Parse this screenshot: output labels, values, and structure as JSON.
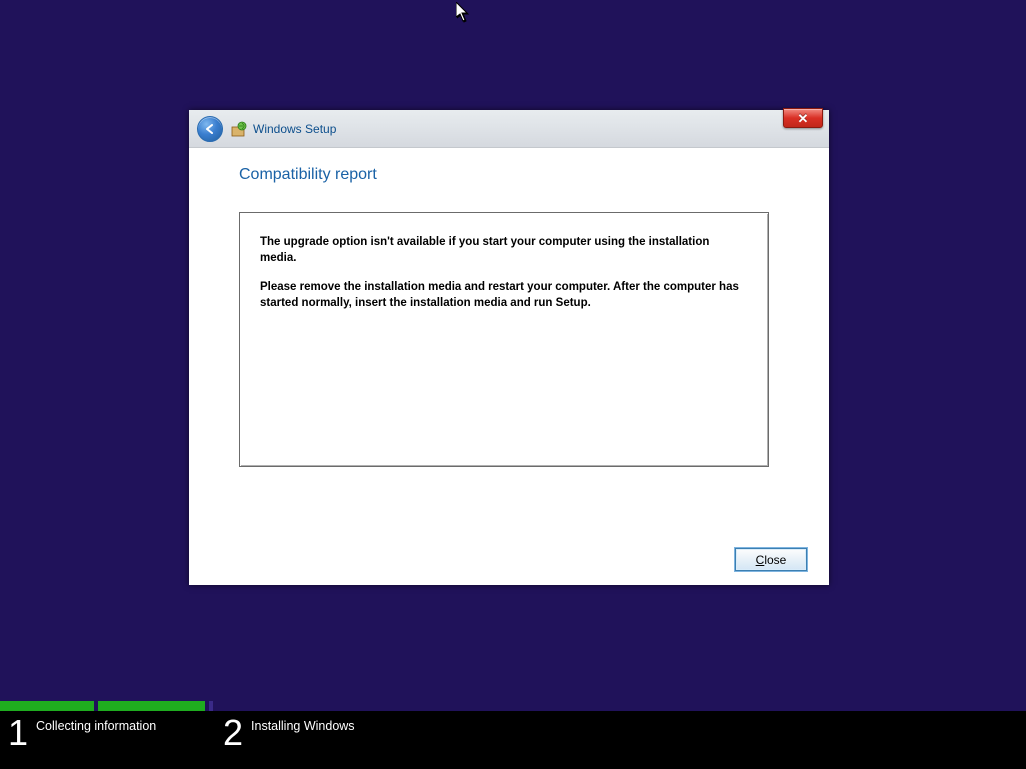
{
  "dialog": {
    "window_title": "Windows Setup",
    "page_title": "Compatibility report",
    "report_p1": "The upgrade option isn't available if you start your computer using the installation media.",
    "report_p2": "Please remove the installation media and restart your computer. After the computer has started normally, insert the installation media and run Setup.",
    "close_button_label": "Close"
  },
  "steps": {
    "s1_num": "1",
    "s1_label": "Collecting information",
    "s2_num": "2",
    "s2_label": "Installing Windows"
  }
}
